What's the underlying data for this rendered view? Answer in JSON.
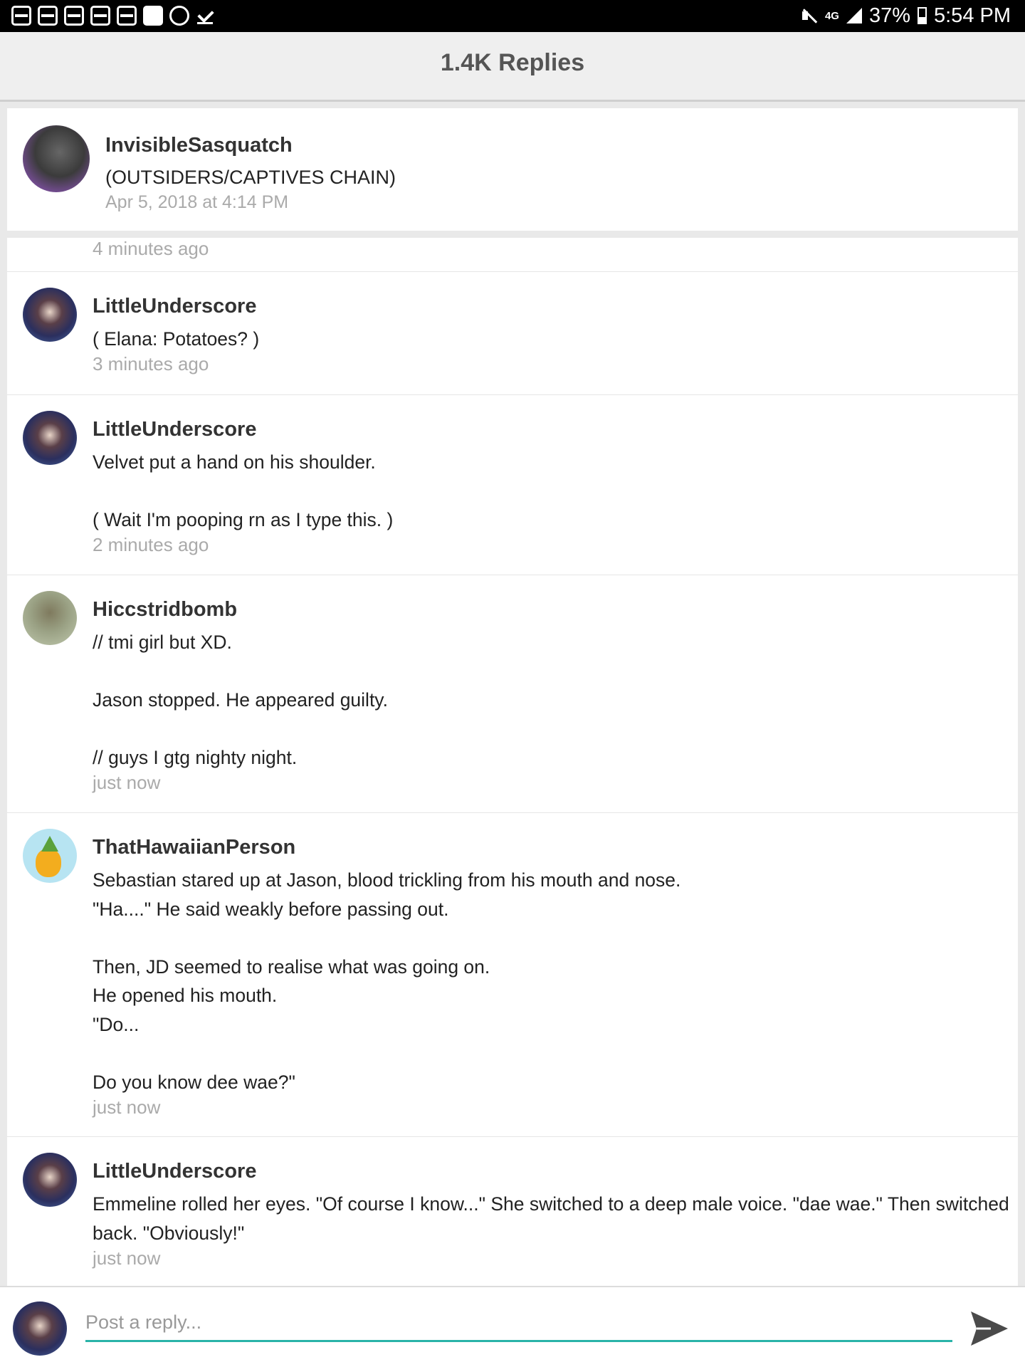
{
  "status_bar": {
    "network": "4G",
    "battery": "37%",
    "time": "5:54 PM",
    "icons": [
      "wattpad-icon",
      "wattpad-icon",
      "gmail-icon",
      "image-icon",
      "gmail-icon",
      "flipboard-icon",
      "emoji-icon",
      "check-icon"
    ]
  },
  "header": {
    "title": "1.4K Replies"
  },
  "original_post": {
    "author": "InvisibleSasquatch",
    "text": "(OUTSIDERS/CAPTIVES CHAIN)",
    "timestamp": "Apr 5, 2018 at 4:14 PM"
  },
  "partial_timestamp": "4 minutes ago",
  "replies": [
    {
      "author": "LittleUnderscore",
      "body": "( Elana: Potatoes? )",
      "time": "3 minutes ago"
    },
    {
      "author": "LittleUnderscore",
      "body": "Velvet put a hand on his shoulder.\n\n( Wait I'm pooping rn as I type this. )",
      "time": "2 minutes ago"
    },
    {
      "author": "Hiccstridbomb",
      "body": "// tmi girl but XD.\n\nJason stopped. He appeared guilty.\n\n// guys I gtg nighty night.",
      "time": "just now"
    },
    {
      "author": "ThatHawaiianPerson",
      "body": "Sebastian stared up at Jason, blood trickling from his mouth and nose.\n\"Ha....\" He said weakly before passing out.\n\nThen, JD seemed to realise what was going on.\nHe opened his mouth.\n\"Do...\n\nDo you know dee wae?\"",
      "time": "just now"
    },
    {
      "author": "LittleUnderscore",
      "body": "Emmeline rolled her eyes. \"Of course I know...\" She switched to a deep male voice. \"dae wae.\" Then switched back. \"Obviously!\"",
      "time": "just now"
    }
  ],
  "compose": {
    "placeholder": "Post a reply..."
  },
  "colors": {
    "accent": "#2ab3a8",
    "muted_text": "#aaaaaa",
    "status_bar": "#000000"
  }
}
